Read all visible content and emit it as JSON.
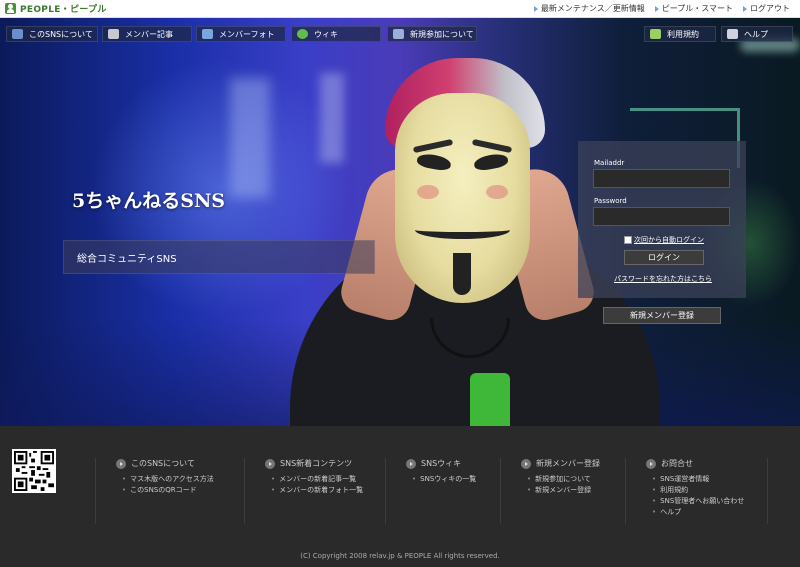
{
  "header": {
    "brand": "PEOPLE・ピープル",
    "links": [
      "最新メンテナンス／更新情報",
      "ピープル・スマート",
      "ログアウト"
    ]
  },
  "nav": {
    "left": [
      "このSNSについて",
      "メンバー記事",
      "メンバーフォト",
      "ウィキ",
      "新規参加について"
    ],
    "right": [
      "利用規約",
      "ヘルプ"
    ]
  },
  "hero": {
    "title": "5ちゃんねるSNS",
    "tagline": "総合コミュニティSNS"
  },
  "login": {
    "mail_label": "Mailaddr",
    "mail_value": "",
    "password_label": "Password",
    "password_value": "",
    "autologin_label": "次回から自動ログイン",
    "login_button": "ログイン",
    "forgot_link": "パスワードを忘れた方はこちら",
    "register_button": "新規メンバー登録"
  },
  "footer": {
    "columns": [
      {
        "title": "このSNSについて",
        "items": [
          "マス木版へのアクセス方法",
          "このSNSのQRコード"
        ]
      },
      {
        "title": "SNS新着コンテンツ",
        "items": [
          "メンバーの新着記事一覧",
          "メンバーの新着フォト一覧"
        ]
      },
      {
        "title": "SNSウィキ",
        "items": [
          "SNSウィキの一覧"
        ]
      },
      {
        "title": "新規メンバー登録",
        "items": [
          "新規参加について",
          "新規メンバー登録"
        ]
      },
      {
        "title": "お問合せ",
        "items": [
          "SNS運営者情報",
          "利用規約",
          "SNS管理者へお願い合わせ",
          "ヘルプ"
        ]
      }
    ],
    "copyright": "(C) Copyright 2008 relav.jp & PEOPLE All rights reserved."
  },
  "colors": {
    "brand_green": "#3a7a2c",
    "footer_bg": "#2a2a2a",
    "hoodie_accent": "#3fb83a"
  }
}
